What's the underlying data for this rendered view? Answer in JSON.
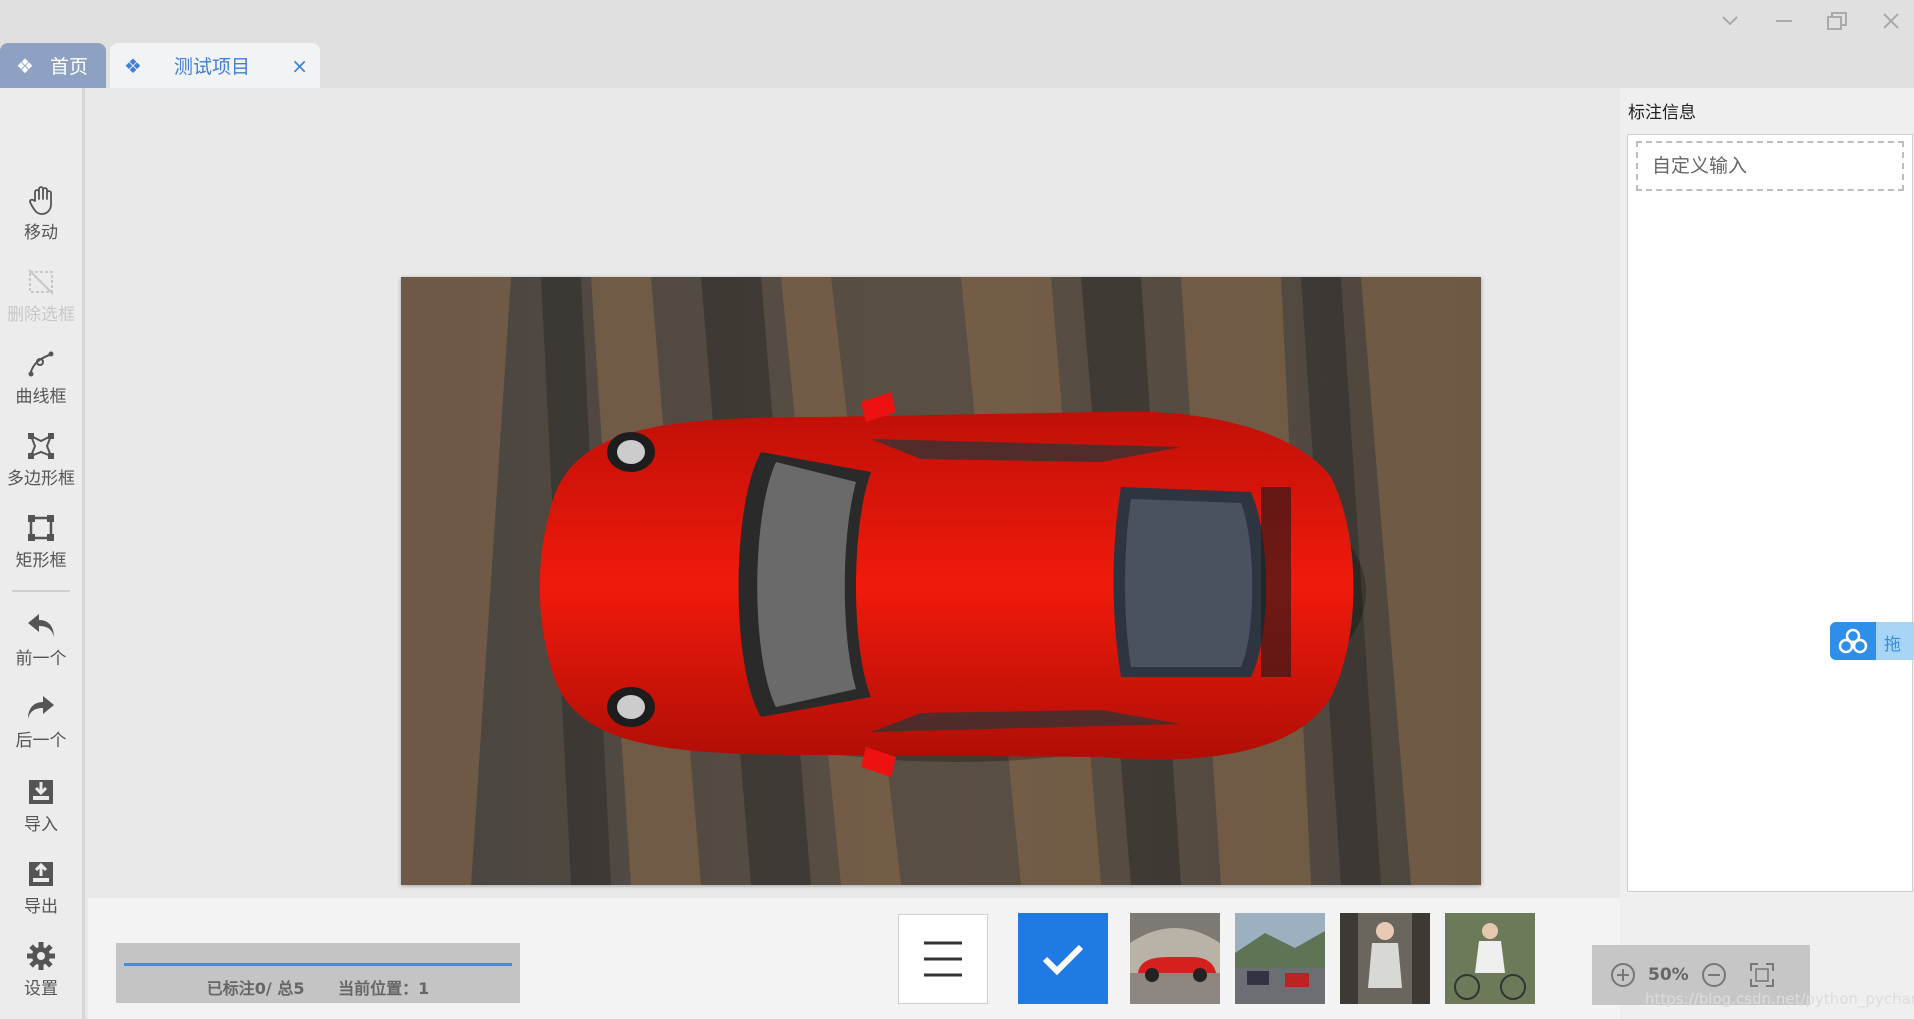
{
  "window": {
    "controls": [
      "chevron-down",
      "minimize",
      "restore",
      "close"
    ]
  },
  "tabs": [
    {
      "label": "首页",
      "icon": "diamond-grid-icon",
      "active": false
    },
    {
      "label": "测试项目",
      "icon": "diamond-grid-icon",
      "active": true,
      "close": "×"
    }
  ],
  "toolbar": {
    "items": [
      {
        "label": "移动",
        "icon": "hand-icon",
        "enabled": true
      },
      {
        "label": "删除选框",
        "icon": "delete-box-icon",
        "enabled": false
      },
      {
        "label": "曲线框",
        "icon": "curve-icon",
        "enabled": true
      },
      {
        "label": "多边形框",
        "icon": "polygon-icon",
        "enabled": true
      },
      {
        "label": "矩形框",
        "icon": "rectangle-icon",
        "enabled": true
      },
      {
        "label": "前一个",
        "icon": "undo-arrow-icon",
        "enabled": true
      },
      {
        "label": "后一个",
        "icon": "redo-arrow-icon",
        "enabled": true
      },
      {
        "label": "导入",
        "icon": "import-icon",
        "enabled": true
      },
      {
        "label": "导出",
        "icon": "export-icon",
        "enabled": true
      },
      {
        "label": "设置",
        "icon": "gear-icon",
        "enabled": true
      }
    ]
  },
  "right_panel": {
    "title": "标注信息",
    "input_placeholder": "自定义输入",
    "floating_widget_text": "拖"
  },
  "bottom": {
    "progress": {
      "labeled": "已标注0/ 总5",
      "position": "当前位置：1"
    },
    "thumbnails": [
      "red sports car in garage",
      "cars on road",
      "woman standing",
      "woman with bicycle"
    ],
    "zoom": "50%"
  },
  "watermark": "https://blog.csdn.net/python_pycharm",
  "colors": {
    "accent": "#1f7ae3",
    "tab_home": "#8ea1c3",
    "tab_active_text": "#3f7fd8"
  }
}
